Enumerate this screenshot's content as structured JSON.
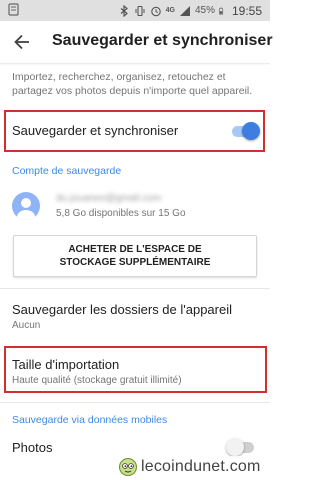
{
  "status_bar": {
    "network": "4G",
    "battery": "45%",
    "time": "19:55",
    "icons": [
      "bluetooth-icon",
      "vibrate-icon",
      "alarm-icon",
      "network-4g-icon",
      "signal-icon",
      "battery-icon"
    ]
  },
  "app_bar": {
    "title": "Sauvegarder et synchroniser",
    "back_icon": "arrow-back-icon"
  },
  "intro_text": "Importez, recherchez, organisez, retouchez et partagez vos photos depuis n'importe quel appareil.",
  "backup_sync": {
    "label": "Sauvegarder et synchroniser",
    "enabled": true
  },
  "backup_account": {
    "section_title": "Compte de sauvegarde",
    "email": "du.jouaneo@gmail.com",
    "storage_text": "5,8 Go disponibles sur 15 Go"
  },
  "buy_storage_button": "ACHETER DE L'ESPACE DE STOCKAGE SUPPLÉMENTAIRE",
  "device_folders": {
    "label": "Sauvegarder les dossiers de l'appareil",
    "value": "Aucun"
  },
  "upload_size": {
    "label": "Taille d'importation",
    "value": "Haute qualité (stockage gratuit illimité)"
  },
  "mobile_data": {
    "section_title": "Sauvegarde via données mobiles",
    "photos_label": "Photos",
    "photos_enabled": false
  },
  "watermark": {
    "text": "lecoindunet.com"
  },
  "colors": {
    "accent": "#3e8ae6",
    "highlight_box": "#d32f2f",
    "toggle_on_track": "#a9c8f3",
    "toggle_on_thumb": "#3d7ee0",
    "toggle_off_track": "#cfcfcf",
    "toggle_off_thumb": "#f2f2f2"
  }
}
